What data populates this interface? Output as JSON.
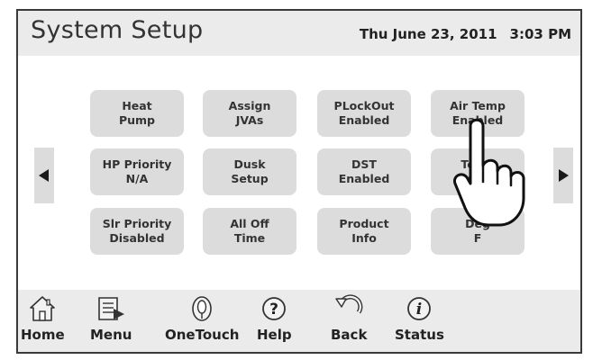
{
  "header": {
    "title": "System Setup",
    "date": "Thu June 23, 2011",
    "time": "3:03 PM"
  },
  "nav": {
    "prev_icon": "left-arrow-icon",
    "next_icon": "right-arrow-icon"
  },
  "buttons": [
    "Heat\nPump",
    "Assign\nJVAs",
    "PLockOut\nEnabled",
    "Air Temp\nEnabled",
    "HP Priority\nN/A",
    "Dusk\nSetup",
    "DST\nEnabled",
    "Temp\nCal",
    "Slr Priority\nDisabled",
    "All Off\nTime",
    "Product\nInfo",
    "Deg\nF"
  ],
  "footer": {
    "tabs": [
      {
        "label": "Home",
        "icon": "home-icon"
      },
      {
        "label": "Menu",
        "icon": "menu-icon"
      },
      {
        "label": "OneTouch",
        "icon": "onetouch-icon"
      },
      {
        "label": "Help",
        "icon": "help-icon"
      },
      {
        "label": "Back",
        "icon": "back-icon"
      },
      {
        "label": "Status",
        "icon": "status-icon"
      }
    ]
  },
  "colors": {
    "header_bg": "#ebebeb",
    "button_bg": "#dcdcdc",
    "border": "#3a3a3a",
    "text": "#333333"
  }
}
